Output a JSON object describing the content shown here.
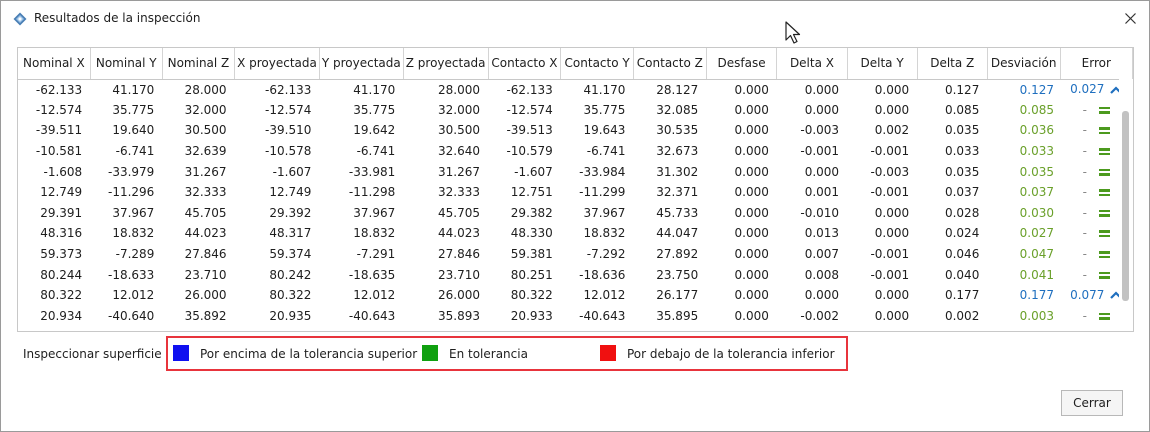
{
  "window": {
    "title": "Resultados de la inspección"
  },
  "table": {
    "columns": [
      "Nominal X",
      "Nominal Y",
      "Nominal Z",
      "X proyectada",
      "Y proyectada",
      "Z proyectada",
      "Contacto X",
      "Contacto Y",
      "Contacto Z",
      "Desfase",
      "Delta X",
      "Delta Y",
      "Delta Z",
      "Desviación",
      "Error"
    ],
    "rows": [
      {
        "cells": [
          "-62.133",
          "41.170",
          "28.000",
          "-62.133",
          "41.170",
          "28.000",
          "-62.133",
          "41.170",
          "28.127",
          "0.000",
          "0.000",
          "0.000",
          "0.127",
          "0.127",
          "0.027"
        ],
        "status": "above"
      },
      {
        "cells": [
          "-12.574",
          "35.775",
          "32.000",
          "-12.574",
          "35.775",
          "32.000",
          "-12.574",
          "35.775",
          "32.085",
          "0.000",
          "0.000",
          "0.000",
          "0.085",
          "0.085",
          "-"
        ],
        "status": "in"
      },
      {
        "cells": [
          "-39.511",
          "19.640",
          "30.500",
          "-39.510",
          "19.642",
          "30.500",
          "-39.513",
          "19.643",
          "30.535",
          "0.000",
          "-0.003",
          "0.002",
          "0.035",
          "0.036",
          "-"
        ],
        "status": "in"
      },
      {
        "cells": [
          "-10.581",
          "-6.741",
          "32.639",
          "-10.578",
          "-6.741",
          "32.640",
          "-10.579",
          "-6.741",
          "32.673",
          "0.000",
          "-0.001",
          "-0.001",
          "0.033",
          "0.033",
          "-"
        ],
        "status": "in"
      },
      {
        "cells": [
          "-1.608",
          "-33.979",
          "31.267",
          "-1.607",
          "-33.981",
          "31.267",
          "-1.607",
          "-33.984",
          "31.302",
          "0.000",
          "0.000",
          "-0.003",
          "0.035",
          "0.035",
          "-"
        ],
        "status": "in"
      },
      {
        "cells": [
          "12.749",
          "-11.296",
          "32.333",
          "12.749",
          "-11.298",
          "32.333",
          "12.751",
          "-11.299",
          "32.371",
          "0.000",
          "0.001",
          "-0.001",
          "0.037",
          "0.037",
          "-"
        ],
        "status": "in"
      },
      {
        "cells": [
          "29.391",
          "37.967",
          "45.705",
          "29.392",
          "37.967",
          "45.705",
          "29.382",
          "37.967",
          "45.733",
          "0.000",
          "-0.010",
          "0.000",
          "0.028",
          "0.030",
          "-"
        ],
        "status": "in"
      },
      {
        "cells": [
          "48.316",
          "18.832",
          "44.023",
          "48.317",
          "18.832",
          "44.023",
          "48.330",
          "18.832",
          "44.047",
          "0.000",
          "0.013",
          "0.000",
          "0.024",
          "0.027",
          "-"
        ],
        "status": "in"
      },
      {
        "cells": [
          "59.373",
          "-7.289",
          "27.846",
          "59.374",
          "-7.291",
          "27.846",
          "59.381",
          "-7.292",
          "27.892",
          "0.000",
          "0.007",
          "-0.001",
          "0.046",
          "0.047",
          "-"
        ],
        "status": "in"
      },
      {
        "cells": [
          "80.244",
          "-18.633",
          "23.710",
          "80.242",
          "-18.635",
          "23.710",
          "80.251",
          "-18.636",
          "23.750",
          "0.000",
          "0.008",
          "-0.001",
          "0.040",
          "0.041",
          "-"
        ],
        "status": "in"
      },
      {
        "cells": [
          "80.322",
          "12.012",
          "26.000",
          "80.322",
          "12.012",
          "26.000",
          "80.322",
          "12.012",
          "26.177",
          "0.000",
          "0.000",
          "0.000",
          "0.177",
          "0.177",
          "0.077"
        ],
        "status": "above"
      },
      {
        "cells": [
          "20.934",
          "-40.640",
          "35.892",
          "20.935",
          "-40.643",
          "35.893",
          "20.933",
          "-40.643",
          "35.895",
          "0.000",
          "-0.002",
          "0.000",
          "0.002",
          "0.003",
          "-"
        ],
        "status": "in"
      }
    ]
  },
  "legend": {
    "label": "Inspeccionar superficie",
    "items": [
      {
        "label": "Por encima de la tolerancia superior",
        "color": "#1010f0"
      },
      {
        "label": "En tolerancia",
        "color": "#10a010"
      },
      {
        "label": "Por debajo de la tolerancia inferior",
        "color": "#f01010"
      }
    ]
  },
  "colors": {
    "above": "#1f6fbf",
    "in": "#6aa02a",
    "highlight_border": "#e8343c"
  },
  "icons": {
    "above": "chevron-up-icon",
    "in": "equals-icon"
  },
  "buttons": {
    "close": "Cerrar"
  }
}
